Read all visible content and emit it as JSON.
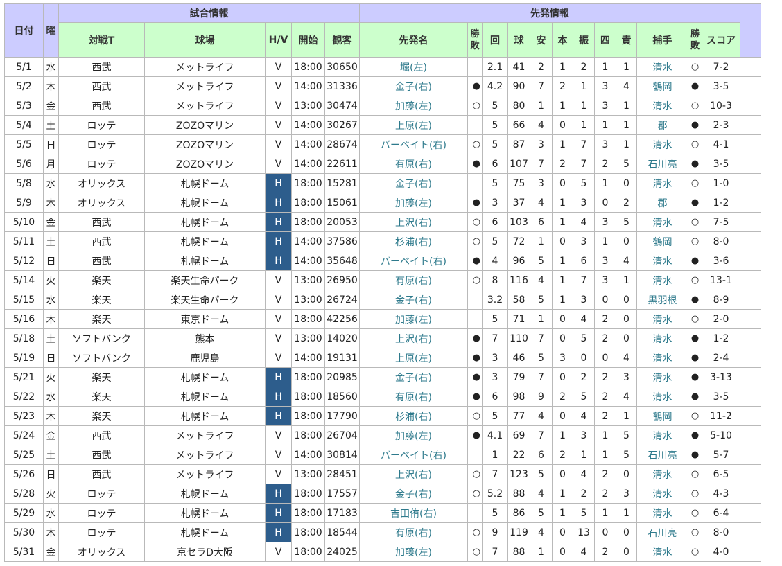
{
  "header": {
    "date": "日付",
    "weekday": "曜",
    "game_info": "試合情報",
    "starter_info": "先発情報",
    "cols": [
      "対戦T",
      "球場",
      "H/V",
      "開始",
      "観客",
      "先発名",
      "勝敗",
      "回",
      "球",
      "安",
      "本",
      "振",
      "四",
      "責",
      "捕手",
      "勝敗",
      "スコア"
    ]
  },
  "colors": {
    "header_green": "#ccffcc",
    "header_lavender": "#ccccff",
    "home_cell": "#2d5d8c",
    "name_text": "#2e7a8c"
  },
  "rows": [
    [
      "5/1",
      "水",
      "西武",
      "メットライフ",
      "V",
      "18:00",
      "30650",
      "堀(左)",
      "",
      "2.1",
      "41",
      "2",
      "1",
      "2",
      "1",
      "1",
      "清水",
      "○",
      "7-2"
    ],
    [
      "5/2",
      "木",
      "西武",
      "メットライフ",
      "V",
      "14:00",
      "31336",
      "金子(右)",
      "●",
      "4.2",
      "90",
      "7",
      "2",
      "1",
      "3",
      "4",
      "鶴岡",
      "●",
      "3-5"
    ],
    [
      "5/3",
      "金",
      "西武",
      "メットライフ",
      "V",
      "13:00",
      "30474",
      "加藤(左)",
      "○",
      "5",
      "80",
      "1",
      "1",
      "1",
      "3",
      "1",
      "清水",
      "○",
      "10-3"
    ],
    [
      "5/4",
      "土",
      "ロッテ",
      "ZOZOマリン",
      "V",
      "14:00",
      "30267",
      "上原(左)",
      "",
      "5",
      "66",
      "4",
      "0",
      "1",
      "1",
      "1",
      "郡",
      "●",
      "2-3"
    ],
    [
      "5/5",
      "日",
      "ロッテ",
      "ZOZOマリン",
      "V",
      "14:00",
      "28674",
      "バーベイト(右)",
      "○",
      "5",
      "87",
      "3",
      "1",
      "7",
      "3",
      "1",
      "清水",
      "○",
      "4-1"
    ],
    [
      "5/6",
      "月",
      "ロッテ",
      "ZOZOマリン",
      "V",
      "14:00",
      "22611",
      "有原(右)",
      "●",
      "6",
      "107",
      "7",
      "2",
      "7",
      "2",
      "5",
      "石川亮",
      "●",
      "3-5"
    ],
    [
      "5/8",
      "水",
      "オリックス",
      "札幌ドーム",
      "H",
      "18:00",
      "15281",
      "金子(右)",
      "",
      "5",
      "75",
      "3",
      "0",
      "5",
      "1",
      "0",
      "清水",
      "○",
      "1-0"
    ],
    [
      "5/9",
      "木",
      "オリックス",
      "札幌ドーム",
      "H",
      "18:00",
      "15061",
      "加藤(左)",
      "●",
      "3",
      "37",
      "4",
      "1",
      "3",
      "0",
      "2",
      "郡",
      "●",
      "1-2"
    ],
    [
      "5/10",
      "金",
      "西武",
      "札幌ドーム",
      "H",
      "18:00",
      "20053",
      "上沢(右)",
      "○",
      "6",
      "103",
      "6",
      "1",
      "4",
      "3",
      "5",
      "清水",
      "○",
      "7-5"
    ],
    [
      "5/11",
      "土",
      "西武",
      "札幌ドーム",
      "H",
      "14:00",
      "37586",
      "杉浦(右)",
      "○",
      "5",
      "72",
      "1",
      "0",
      "3",
      "1",
      "0",
      "鶴岡",
      "○",
      "8-0"
    ],
    [
      "5/12",
      "日",
      "西武",
      "札幌ドーム",
      "H",
      "14:00",
      "35648",
      "バーベイト(右)",
      "●",
      "4",
      "96",
      "5",
      "1",
      "6",
      "3",
      "4",
      "清水",
      "●",
      "3-6"
    ],
    [
      "5/14",
      "火",
      "楽天",
      "楽天生命パーク",
      "V",
      "13:00",
      "26950",
      "有原(右)",
      "○",
      "8",
      "116",
      "4",
      "1",
      "7",
      "3",
      "1",
      "清水",
      "○",
      "13-1"
    ],
    [
      "5/15",
      "水",
      "楽天",
      "楽天生命パーク",
      "V",
      "13:00",
      "26724",
      "金子(右)",
      "",
      "3.2",
      "58",
      "5",
      "1",
      "3",
      "0",
      "0",
      "黒羽根",
      "●",
      "8-9"
    ],
    [
      "5/16",
      "木",
      "楽天",
      "東京ドーム",
      "V",
      "18:00",
      "42256",
      "加藤(左)",
      "",
      "5",
      "71",
      "1",
      "0",
      "4",
      "2",
      "0",
      "清水",
      "○",
      "2-0"
    ],
    [
      "5/18",
      "土",
      "ソフトバンク",
      "熊本",
      "V",
      "13:00",
      "14020",
      "上沢(右)",
      "●",
      "7",
      "110",
      "7",
      "0",
      "5",
      "2",
      "0",
      "清水",
      "●",
      "1-2"
    ],
    [
      "5/19",
      "日",
      "ソフトバンク",
      "鹿児島",
      "V",
      "14:00",
      "19131",
      "上原(左)",
      "●",
      "3",
      "46",
      "5",
      "3",
      "0",
      "0",
      "4",
      "清水",
      "●",
      "2-4"
    ],
    [
      "5/21",
      "火",
      "楽天",
      "札幌ドーム",
      "H",
      "18:00",
      "20985",
      "金子(右)",
      "●",
      "3",
      "79",
      "7",
      "0",
      "2",
      "2",
      "3",
      "清水",
      "●",
      "3-13"
    ],
    [
      "5/22",
      "水",
      "楽天",
      "札幌ドーム",
      "H",
      "18:00",
      "18560",
      "有原(右)",
      "●",
      "6",
      "98",
      "9",
      "2",
      "5",
      "2",
      "4",
      "清水",
      "●",
      "3-5"
    ],
    [
      "5/23",
      "木",
      "楽天",
      "札幌ドーム",
      "H",
      "18:00",
      "17790",
      "杉浦(右)",
      "○",
      "5",
      "77",
      "4",
      "0",
      "4",
      "2",
      "1",
      "鶴岡",
      "○",
      "11-2"
    ],
    [
      "5/24",
      "金",
      "西武",
      "メットライフ",
      "V",
      "18:00",
      "26704",
      "加藤(左)",
      "●",
      "4.1",
      "69",
      "7",
      "1",
      "3",
      "1",
      "5",
      "清水",
      "●",
      "5-10"
    ],
    [
      "5/25",
      "土",
      "西武",
      "メットライフ",
      "V",
      "14:00",
      "30814",
      "バーベイト(右)",
      "",
      "1",
      "22",
      "6",
      "2",
      "1",
      "1",
      "5",
      "石川亮",
      "●",
      "5-7"
    ],
    [
      "5/26",
      "日",
      "西武",
      "メットライフ",
      "V",
      "13:00",
      "28451",
      "上沢(右)",
      "○",
      "7",
      "123",
      "5",
      "0",
      "4",
      "2",
      "0",
      "清水",
      "○",
      "6-5"
    ],
    [
      "5/28",
      "火",
      "ロッテ",
      "札幌ドーム",
      "H",
      "18:00",
      "17557",
      "金子(右)",
      "○",
      "5.2",
      "88",
      "4",
      "1",
      "2",
      "2",
      "3",
      "清水",
      "○",
      "4-3"
    ],
    [
      "5/29",
      "水",
      "ロッテ",
      "札幌ドーム",
      "H",
      "18:00",
      "17183",
      "吉田侑(右)",
      "",
      "5",
      "86",
      "5",
      "1",
      "5",
      "1",
      "1",
      "清水",
      "○",
      "6-4"
    ],
    [
      "5/30",
      "木",
      "ロッテ",
      "札幌ドーム",
      "H",
      "18:00",
      "18544",
      "有原(右)",
      "○",
      "9",
      "119",
      "4",
      "0",
      "13",
      "0",
      "0",
      "石川亮",
      "○",
      "8-0"
    ],
    [
      "5/31",
      "金",
      "オリックス",
      "京セラD大阪",
      "V",
      "18:00",
      "24025",
      "加藤(左)",
      "○",
      "7",
      "88",
      "1",
      "0",
      "4",
      "2",
      "0",
      "清水",
      "○",
      "4-0"
    ]
  ]
}
